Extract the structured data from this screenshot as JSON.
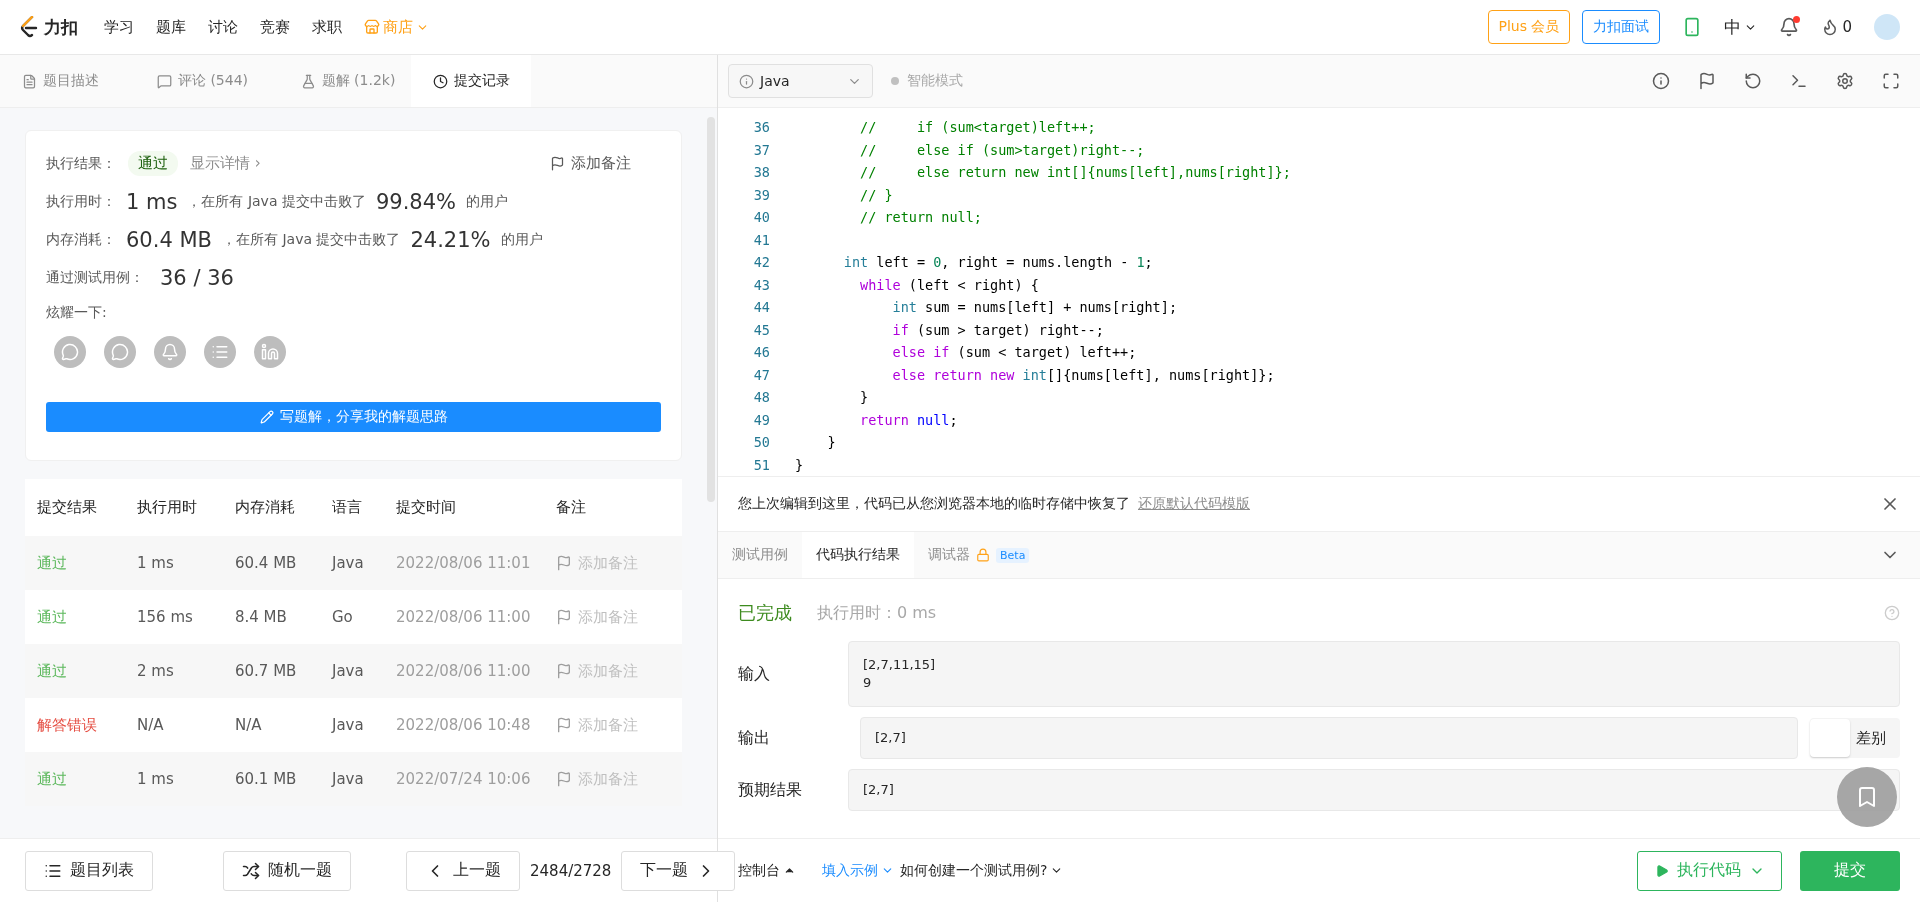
{
  "nav": {
    "logo": "力扣",
    "items": [
      {
        "label": "学习",
        "kind": "plain"
      },
      {
        "label": "题库",
        "kind": "plain"
      },
      {
        "label": "讨论",
        "kind": "plain"
      },
      {
        "label": "竞赛",
        "kind": "plain"
      },
      {
        "label": "求职",
        "kind": "plain"
      },
      {
        "label": "商店",
        "kind": "store"
      }
    ],
    "plus": "Plus 会员",
    "interview": "力扣面试",
    "language": "中",
    "notification_dot": true,
    "points": "0"
  },
  "tabs": [
    {
      "label": "题目描述",
      "selected": false
    },
    {
      "label": "评论 (544)",
      "selected": false
    },
    {
      "label": "题解 (1.2k)",
      "selected": false
    },
    {
      "label": "提交记录",
      "selected": true
    }
  ],
  "result_card": {
    "result_label": "执行结果：",
    "result": "通过",
    "details": "显示详情 ›",
    "add_note": "添加备注",
    "stats": [
      {
        "label": "执行用时：",
        "value": "1 ms",
        "middle": "，在所有 Java 提交中击败了",
        "percent": "99.84%",
        "tail": "的用户"
      },
      {
        "label": "内存消耗：",
        "value": "60.4 MB",
        "middle": "，在所有 Java 提交中击败了",
        "percent": "24.21%",
        "tail": "的用户"
      }
    ],
    "cases_label": "通过测试用例：",
    "cases": "36 / 36",
    "share_label": "炫耀一下:",
    "write_button": "写题解，分享我的解题思路"
  },
  "submissions": {
    "columns": [
      "提交结果",
      "执行用时",
      "内存消耗",
      "语言",
      "提交时间",
      "备注"
    ],
    "rows": [
      {
        "status": "通过",
        "kind": "accepted",
        "time": "1 ms",
        "memory": "60.4 MB",
        "lang": "Java",
        "date": "2022/08/06 11:01",
        "note": "添加备注"
      },
      {
        "status": "通过",
        "kind": "accepted",
        "time": "156 ms",
        "memory": "8.4 MB",
        "lang": "Go",
        "date": "2022/08/06 11:00",
        "note": "添加备注"
      },
      {
        "status": "通过",
        "kind": "accepted",
        "time": "2 ms",
        "memory": "60.7 MB",
        "lang": "Java",
        "date": "2022/08/06 11:00",
        "note": "添加备注"
      },
      {
        "status": "解答错误",
        "kind": "wrong",
        "time": "N/A",
        "memory": "N/A",
        "lang": "Java",
        "date": "2022/08/06 10:48",
        "note": "添加备注"
      },
      {
        "status": "通过",
        "kind": "accepted",
        "time": "1 ms",
        "memory": "60.1 MB",
        "lang": "Java",
        "date": "2022/07/24 10:06",
        "note": "添加备注"
      }
    ]
  },
  "left_footer": {
    "list": "题目列表",
    "random": "随机一题",
    "prev": "上一题",
    "counter": "2484/2728",
    "next": "下一题"
  },
  "editor": {
    "language": "Java",
    "smart_mode": {
      "label": "智能模式",
      "on": false
    },
    "lines": [
      {
        "no": "36",
        "tokens": [
          {
            "kind": "comment",
            "text": "        //     if (sum<target)left++;"
          }
        ]
      },
      {
        "no": "37",
        "tokens": [
          {
            "kind": "comment",
            "text": "        //     else if (sum>target)right--;"
          }
        ]
      },
      {
        "no": "38",
        "tokens": [
          {
            "kind": "comment",
            "text": "        //     else return new int[]{nums[left],nums[right]};"
          }
        ]
      },
      {
        "no": "39",
        "tokens": [
          {
            "kind": "comment",
            "text": "        // }"
          }
        ]
      },
      {
        "no": "40",
        "tokens": [
          {
            "kind": "comment",
            "text": "        // return null;"
          }
        ]
      },
      {
        "no": "41"
      },
      {
        "no": "42",
        "tokens": [
          {
            "kind": "type",
            "text": "      int"
          },
          {
            "kind": "plain",
            "text": " left = "
          },
          {
            "kind": "num",
            "text": "0"
          },
          {
            "kind": "plain",
            "text": ", right = nums.length - "
          },
          {
            "kind": "num",
            "text": "1"
          },
          {
            "kind": "plain",
            "text": ";"
          }
        ]
      },
      {
        "no": "43",
        "tokens": [
          {
            "kind": "kw",
            "text": "        while"
          },
          {
            "kind": "plain",
            "text": " (left < right) {"
          }
        ]
      },
      {
        "no": "44",
        "tokens": [
          {
            "kind": "type",
            "text": "            int"
          },
          {
            "kind": "plain",
            "text": " sum = nums[left] + nums[right];"
          }
        ]
      },
      {
        "no": "45",
        "tokens": [
          {
            "kind": "kw",
            "text": "            if"
          },
          {
            "kind": "plain",
            "text": " (sum > target) right--;"
          }
        ]
      },
      {
        "no": "46",
        "tokens": [
          {
            "kind": "kw",
            "text": "            else if"
          },
          {
            "kind": "plain",
            "text": " (sum < target) left++;"
          }
        ]
      },
      {
        "no": "47",
        "tokens": [
          {
            "kind": "kw",
            "text": "            else return new "
          },
          {
            "kind": "type",
            "text": "int"
          },
          {
            "kind": "plain",
            "text": "[]{nums[left], nums[right]};"
          }
        ]
      },
      {
        "no": "48",
        "tokens": [
          {
            "kind": "plain",
            "text": "        }"
          }
        ]
      },
      {
        "no": "49",
        "tokens": [
          {
            "kind": "kw",
            "text": "        return "
          },
          {
            "kind": "null",
            "text": "null"
          },
          {
            "kind": "plain",
            "text": ";"
          }
        ]
      },
      {
        "no": "50",
        "tokens": [
          {
            "kind": "plain",
            "text": "    }"
          }
        ]
      },
      {
        "no": "51",
        "tokens": [
          {
            "kind": "plain",
            "text": "}"
          }
        ]
      }
    ]
  },
  "notice": {
    "text": "您上次编辑到这里，代码已从您浏览器本地的临时存储中恢复了",
    "link": "还原默认代码模版"
  },
  "console_tabs": [
    {
      "label": "测试用例",
      "selected": false
    },
    {
      "label": "代码执行结果",
      "selected": true
    },
    {
      "label": "调试器",
      "selected": false,
      "badge": "Beta"
    }
  ],
  "run_result": {
    "status": "已完成",
    "time": "执行用时：0 ms",
    "input_label": "输入",
    "input": [
      "[2,7,11,15]",
      "9"
    ],
    "output_label": "输出",
    "output": "[2,7]",
    "diff_label": "差别",
    "diff_on": false,
    "expected_label": "预期结果",
    "expected": "[2,7]"
  },
  "console_footer": {
    "console": "控制台",
    "example": "填入示例",
    "howto": "如何创建一个测试用例?",
    "run": "执行代码",
    "submit": "提交"
  }
}
